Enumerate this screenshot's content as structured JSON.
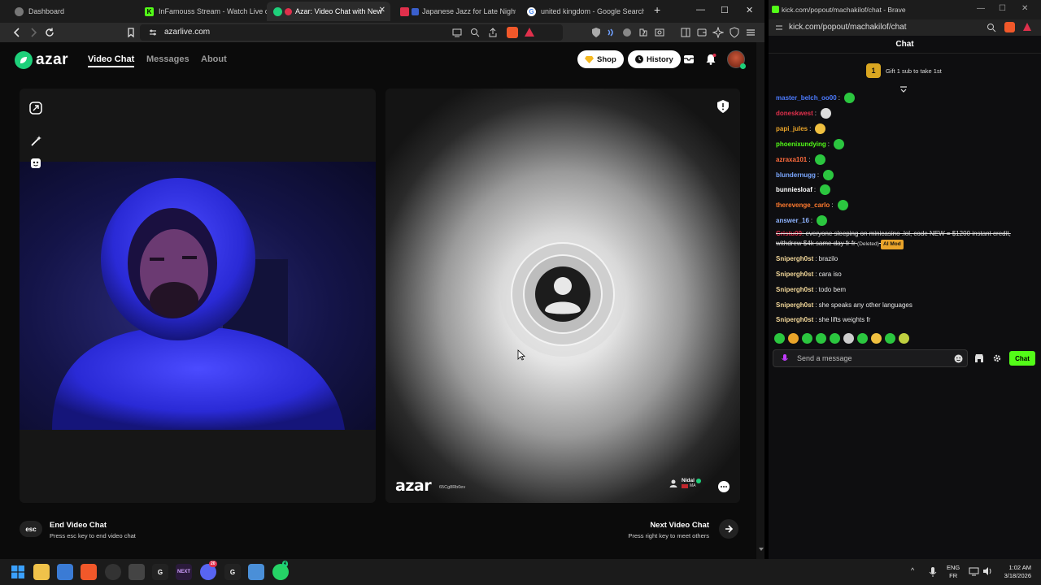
{
  "tabs": [
    {
      "title": "Dashboard",
      "icon": "chrome-tab-icon"
    },
    {
      "title": "InFamouss Stream - Watch Live on",
      "icon": "kick-logo-icon"
    },
    {
      "title": "Azar: Video Chat with New",
      "icon": "azar-logo-icon",
      "active": true
    },
    {
      "title": "Japanese Jazz for Late Night Fo",
      "icon": "youtube-icon"
    },
    {
      "title": "united kingdom - Google Search",
      "icon": "google-icon"
    }
  ],
  "address": {
    "url": "azarlive.com"
  },
  "azar": {
    "logo": "azar",
    "nav": {
      "video_chat": "Video Chat",
      "messages": "Messages",
      "about": "About"
    },
    "shop_label": "Shop",
    "history_label": "History",
    "peer": {
      "name": "Nidal",
      "country": "MA"
    },
    "pip_logo": "azar",
    "pip_code": "65Cg8Rb0ev",
    "end": {
      "key": "esc",
      "title": "End Video Chat",
      "subtitle": "Press esc key to end video chat"
    },
    "next": {
      "title": "Next Video Chat",
      "subtitle": "Press right key to meet others"
    }
  },
  "popout": {
    "window_title": "kick.com/popout/machakilof/chat - Brave",
    "url": "kick.com/popout/machakilof/chat",
    "chat_header": "Chat",
    "gift_rank": "1",
    "gift_text": "Gift 1 sub to take 1st",
    "messages": [
      {
        "user": "master_belch_oo00",
        "color": "#4c7bff",
        "text": ":"
      },
      {
        "user": "doneskwest",
        "color": "#e0304c",
        "text": ":"
      },
      {
        "user": "papi_jules",
        "color": "#e9a42a",
        "text": ":"
      },
      {
        "user": "phoenixundying",
        "color": "#53fc18",
        "text": ":"
      },
      {
        "user": "azraxa101",
        "color": "#ff6b3d",
        "text": ":"
      },
      {
        "user": "blundernugg",
        "color": "#7aa7ff",
        "text": ":"
      },
      {
        "user": "bunniesloaf",
        "color": "#ffffff",
        "text": ":"
      },
      {
        "user": "therevenge_carlo",
        "color": "#ff7a2e",
        "text": ":"
      },
      {
        "user": "answer_16",
        "color": "#8fb4ff",
        "text": ":"
      }
    ],
    "deleted": {
      "user": "Cristu09",
      "text": ": everyone sleeping on minicasino .lol, code NEW = $1200 instant credit, withdrew $4k same day fr fr",
      "deleted_label": "(Deleted)",
      "tag": "AI Mod"
    },
    "snip_messages": [
      {
        "user": "Snipergh0st",
        "text": ": brazilo"
      },
      {
        "user": "Snipergh0st",
        "text": ": cara iso"
      },
      {
        "user": "Snipergh0st",
        "text": ": todo bem"
      },
      {
        "user": "Snipergh0st",
        "text": ": she speaks any other languages"
      },
      {
        "user": "Snipergh0st",
        "text": ": she lifts weights fr"
      }
    ],
    "input_placeholder": "Send a message",
    "chat_button": "Chat"
  },
  "taskbar": {
    "lang_top": "ENG",
    "lang_bottom": "FR",
    "time": "1:02 AM",
    "date": "3/18/2026",
    "badge_discord": "20",
    "badge_whatsapp": "4",
    "next_label": "NEXT"
  },
  "colors": {
    "azar_green": "#1ed07a",
    "kick_green": "#53fc18",
    "gold": "#d9a621"
  }
}
